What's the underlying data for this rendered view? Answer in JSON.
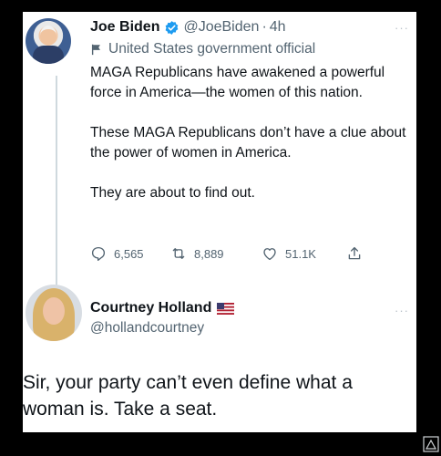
{
  "tweet1": {
    "name": "Joe Biden",
    "handle": "@JoeBiden",
    "separator": "·",
    "time": "4h",
    "more": "···",
    "label": "United States government official",
    "paragraphs": [
      "MAGA Republicans have awakened a powerful force in America—the women of this nation.",
      "These MAGA Republicans don’t have a clue about the power of women in America.",
      "They are about to find out."
    ],
    "replies": "6,565",
    "retweets": "8,889",
    "likes": "51.1K",
    "colors": {
      "verified": "#1d9bf0",
      "secondary": "#536471"
    },
    "icons": [
      "verified-badge-icon",
      "government-flag-icon",
      "reply-icon",
      "retweet-icon",
      "like-icon",
      "share-icon"
    ]
  },
  "tweet2": {
    "name": "Courtney Holland",
    "handle": "@hollandcourtney",
    "more": "···",
    "text": "Sir, your party can’t even define what a woman is. Take a seat.",
    "icons": [
      "us-flag-emoji-icon"
    ]
  }
}
